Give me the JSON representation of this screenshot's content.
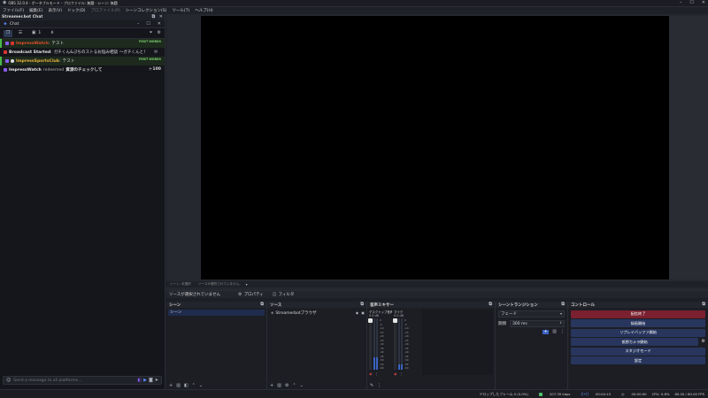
{
  "window": {
    "title": "OBS 32.0.4 - ポータブルモード - プロファイル: 無題 - シーン: 無題"
  },
  "menu": [
    {
      "label": "ファイル(F)",
      "enabled": true
    },
    {
      "label": "編集(E)",
      "enabled": true
    },
    {
      "label": "表示(V)",
      "enabled": true
    },
    {
      "label": "ドック(D)",
      "enabled": true
    },
    {
      "label": "プロファイル(P)",
      "enabled": false
    },
    {
      "label": "シーンコレクション(S)",
      "enabled": true
    },
    {
      "label": "ツール(T)",
      "enabled": true
    },
    {
      "label": "ヘルプ(H)",
      "enabled": true
    }
  ],
  "chat_dock": {
    "title": "Streamer.bot Chat",
    "tab": "Chat",
    "viewer_count": "1",
    "input_placeholder": "Send a message to all platforms...",
    "messages": [
      {
        "user": "ImpressWatch",
        "user_color": "#e0502a",
        "sep": ":",
        "text": "テスト",
        "badge": "FIRST WORDS",
        "highlight": true
      },
      {
        "user": "Broadcast Started",
        "user_color": "#e6e6e6",
        "sep": ":",
        "text": "ガチくん&ぷちのストるお悩み相談 ～ガチくんと！",
        "badge": "",
        "highlight": false
      },
      {
        "user": "ImpressSportsClub",
        "user_color": "#e9b23a",
        "sep": ":",
        "text": "テスト",
        "badge": "FIRST WORDS",
        "highlight": true
      },
      {
        "user": "ImpressWatch",
        "user_color": "#e6e6e6",
        "sep": "",
        "text": "redeemed",
        "reward": "資源のチェックして",
        "points": "100",
        "badge": "",
        "highlight": false
      }
    ]
  },
  "scene_bar": {
    "left": "シーン: 未選択",
    "hint": "ソースが選択されていません。"
  },
  "context_bar": {
    "no_source": "ソースが選択されていません",
    "properties": "プロパティ",
    "filters": "フィルタ"
  },
  "scenes": {
    "title": "シーン",
    "items": [
      "シーン"
    ]
  },
  "sources": {
    "title": "ソース",
    "items": [
      "Streamerbotブラウザ"
    ]
  },
  "mixer": {
    "title": "音声ミキサー",
    "channels": [
      {
        "name": "デスクトップ音声",
        "db": "0.0 dB",
        "level": 0.25
      },
      {
        "name": "マイク",
        "db": "0.0 dB",
        "level": 0.1
      }
    ],
    "scale": [
      "0",
      "-5",
      "-10",
      "-15",
      "-20",
      "-25",
      "-30",
      "-35",
      "-40",
      "-45",
      "-50",
      "-55",
      "-60"
    ]
  },
  "transitions": {
    "title": "シーントランジション",
    "type": "フェード",
    "duration_label": "期間",
    "duration": "300 ms"
  },
  "controls": {
    "title": "コントロール",
    "buttons": [
      {
        "label": "配信終了",
        "color": "#7a2030"
      },
      {
        "label": "録画開始",
        "color": "#28365e"
      },
      {
        "label": "リプレイバッファ開始",
        "color": "#28365e"
      },
      {
        "label": "仮想カメラ開始",
        "color": "#28365e"
      },
      {
        "label": "スタジオモード",
        "color": "#28365e"
      },
      {
        "label": "設定",
        "color": "#28365e"
      }
    ]
  },
  "status": {
    "frames": "ドロップしたフレーム 0 (0.0%)",
    "bitrate": "207.35 kbps",
    "live_time": "00:04:15",
    "rec_time": "00:00:00",
    "cpu": "CPU: 0.8%",
    "fps": "60.00 / 60.00 FPS"
  }
}
